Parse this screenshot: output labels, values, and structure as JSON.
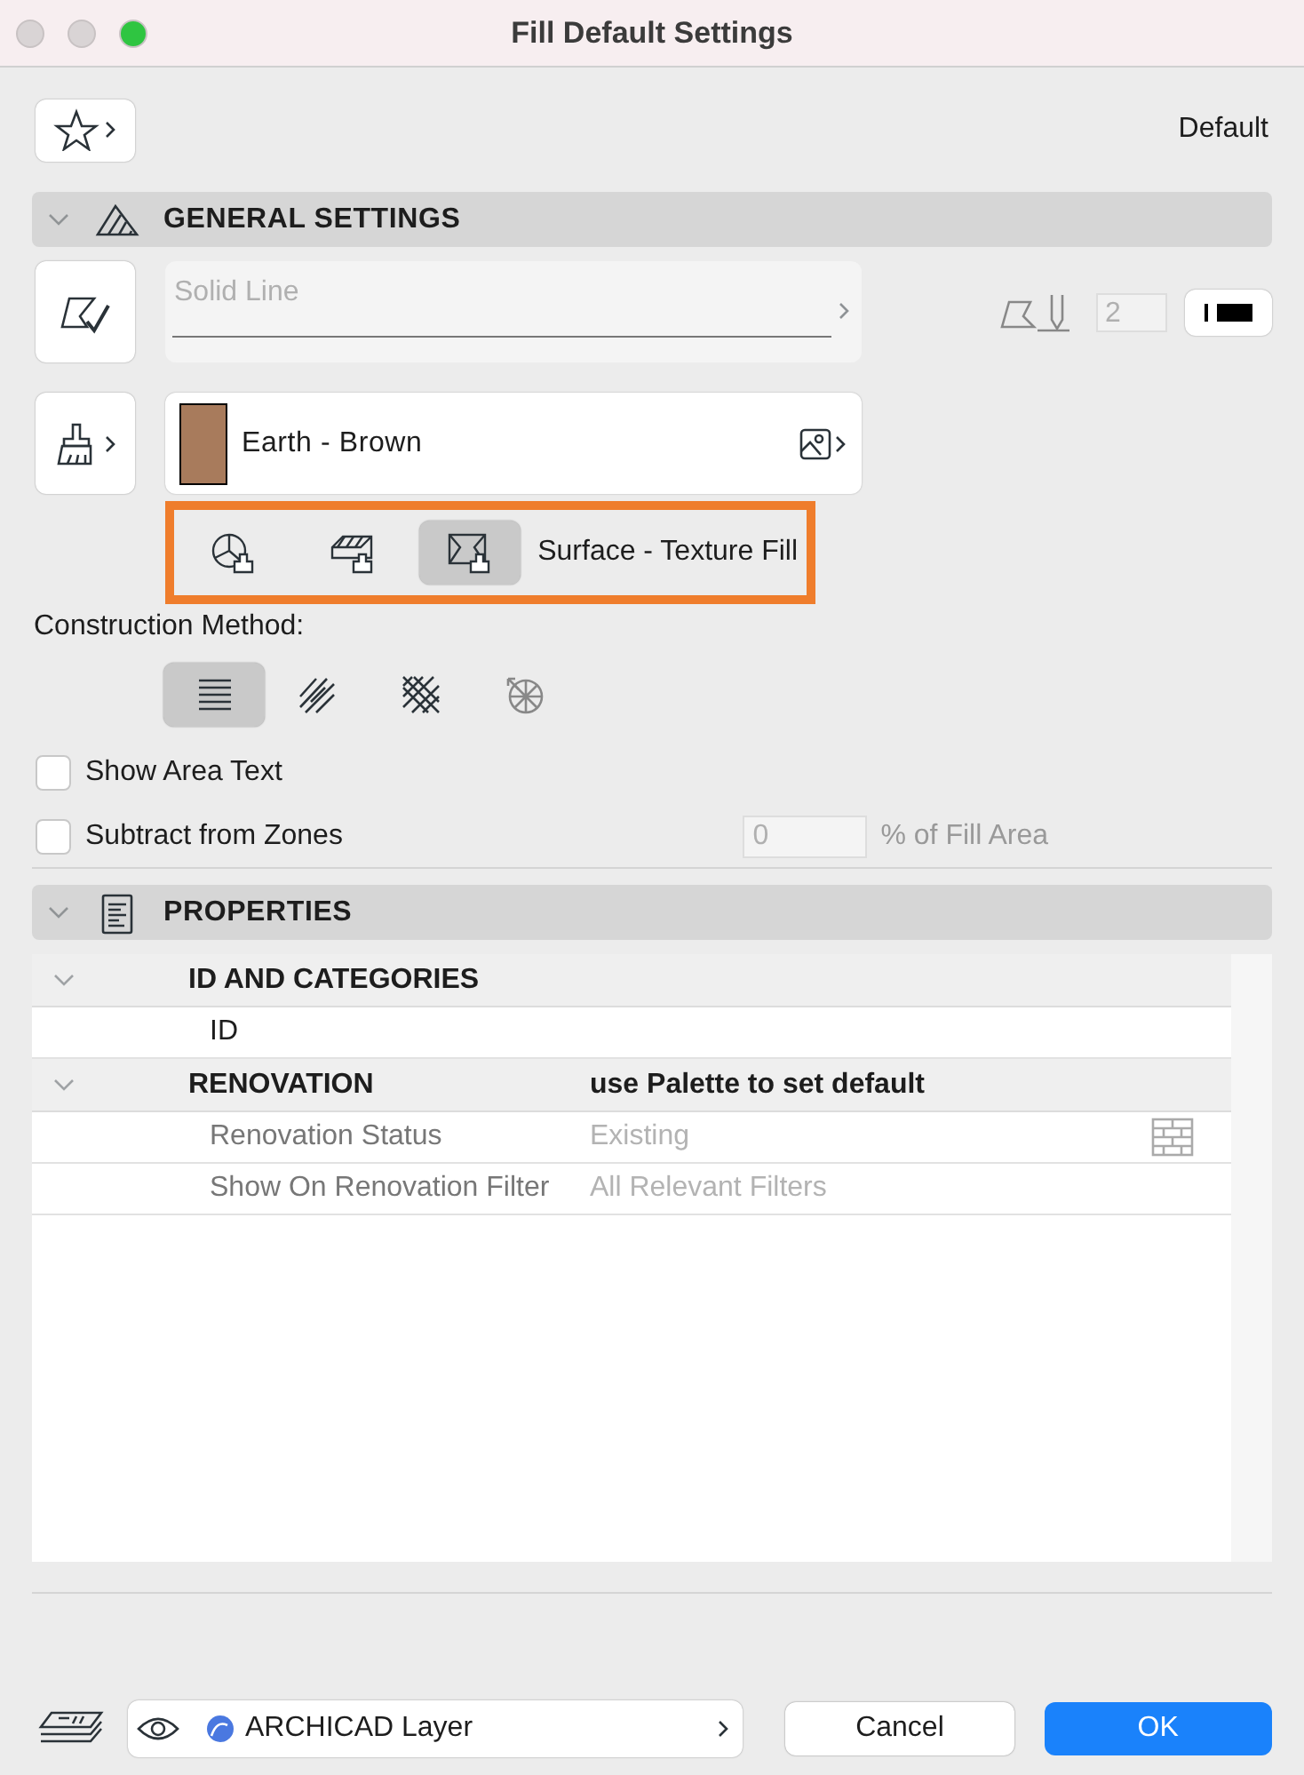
{
  "window": {
    "title": "Fill Default Settings"
  },
  "favorites": {
    "label": "Default"
  },
  "general_settings": {
    "title": "GENERAL SETTINGS",
    "expanded": true,
    "line_type": {
      "value": "Solid Line",
      "disabled": true
    },
    "pen": {
      "value": "2",
      "disabled": true
    },
    "fill": {
      "name": "Earth - Brown",
      "color": "#a87b5c"
    },
    "fill_types": [
      {
        "kind": "polygon",
        "selected": false
      },
      {
        "kind": "cut",
        "selected": false
      },
      {
        "kind": "surface",
        "selected": true
      }
    ],
    "fill_type_label": "Surface - Texture Fill",
    "construction_label": "Construction Method:",
    "construction_methods": [
      {
        "kind": "lines",
        "selected": true
      },
      {
        "kind": "hatch",
        "selected": false
      },
      {
        "kind": "cross",
        "selected": false
      },
      {
        "kind": "radial",
        "selected": false
      }
    ],
    "checkboxes": [
      {
        "label": "Show Area Text",
        "checked": false
      },
      {
        "label": "Subtract from Zones",
        "checked": false
      }
    ],
    "fill_area": {
      "value": "0",
      "suffix": "% of Fill Area",
      "disabled": true
    }
  },
  "properties": {
    "title": "PROPERTIES",
    "expanded": true,
    "rows": [
      {
        "kind": "group",
        "name": "ID AND CATEGORIES",
        "expanded": true
      },
      {
        "kind": "row",
        "name": "ID",
        "disabled": false
      },
      {
        "kind": "group",
        "name": "RENOVATION",
        "value": "use Palette to set default",
        "expanded": true
      },
      {
        "kind": "row",
        "name": "Renovation Status",
        "value": "Existing",
        "disabled": true,
        "icon": true
      },
      {
        "kind": "row",
        "name": "Show On Renovation Filter",
        "value": "All Relevant Filters",
        "disabled": true
      }
    ]
  },
  "layer": {
    "name": "ARCHICAD Layer"
  },
  "buttons": [
    {
      "label": "Cancel",
      "kind": "secondary"
    },
    {
      "label": "OK",
      "kind": "primary"
    }
  ]
}
